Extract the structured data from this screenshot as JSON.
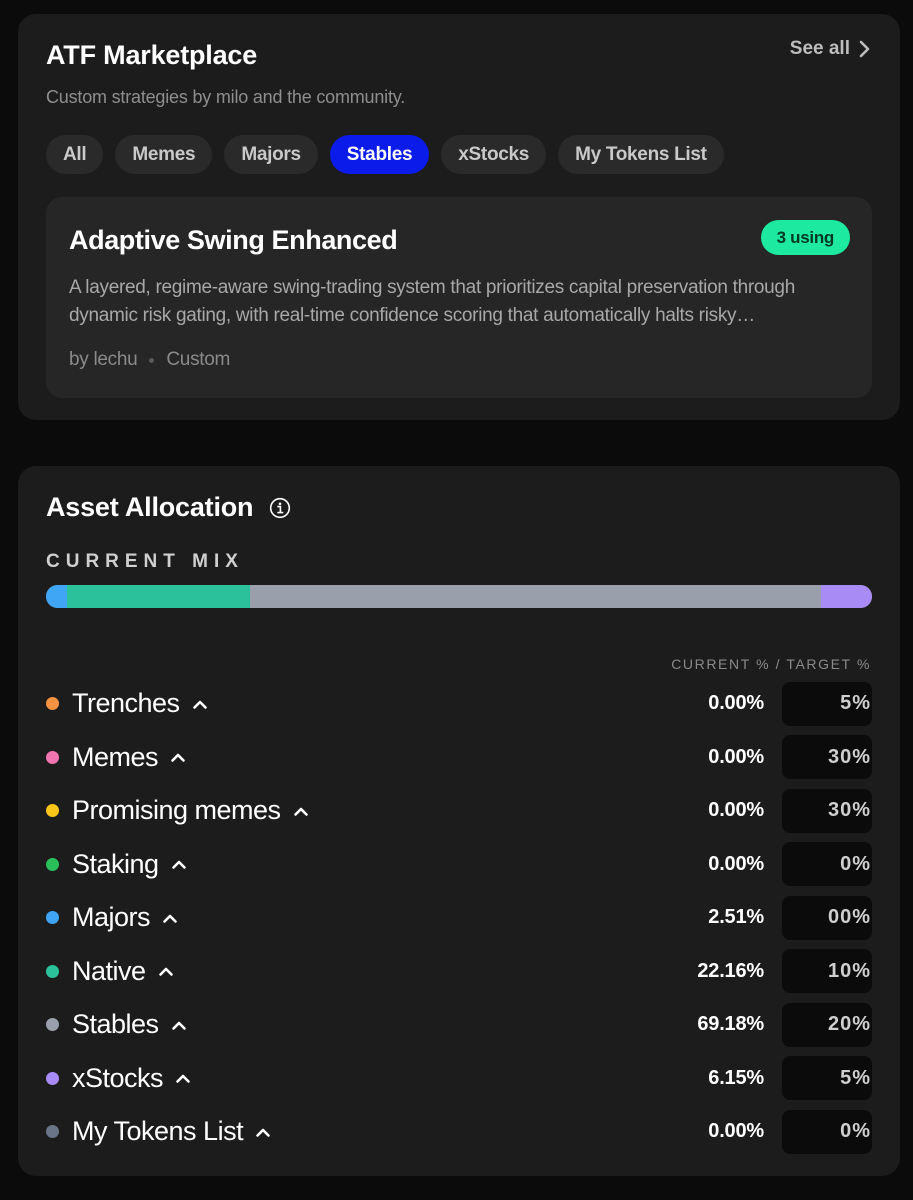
{
  "marketplace": {
    "title": "ATF Marketplace",
    "subtitle": "Custom strategies by milo and the community.",
    "see_all": "See all",
    "chips": [
      {
        "label": "All",
        "active": false
      },
      {
        "label": "Memes",
        "active": false
      },
      {
        "label": "Majors",
        "active": false
      },
      {
        "label": "Stables",
        "active": true
      },
      {
        "label": "xStocks",
        "active": false
      },
      {
        "label": "My Tokens List",
        "active": false
      }
    ],
    "strategy": {
      "title": "Adaptive Swing Enhanced",
      "badge": "3 using",
      "description": "A layered, regime-aware swing-trading system that prioritizes capital preservation through dynamic risk gating, with real-time confidence scoring that automatically halts risky…",
      "author": "by lechu",
      "type": "Custom"
    }
  },
  "allocation": {
    "title": "Asset Allocation",
    "mix_label": "CURRENT MIX",
    "column_header": "CURRENT % / TARGET %",
    "mix_segments": [
      {
        "name": "Majors",
        "percent": 2.51,
        "color": "#3ea6f5"
      },
      {
        "name": "Native",
        "percent": 22.16,
        "color": "#2bc29b"
      },
      {
        "name": "Stables",
        "percent": 69.18,
        "color": "#9aa0ab"
      },
      {
        "name": "xStocks",
        "percent": 6.15,
        "color": "#a98bf5"
      }
    ],
    "rows": [
      {
        "name": "Trenches",
        "color": "#f59342",
        "current": "0.00%",
        "target": "5%"
      },
      {
        "name": "Memes",
        "color": "#f074b0",
        "current": "0.00%",
        "target": "30%"
      },
      {
        "name": "Promising memes",
        "color": "#f7c619",
        "current": "0.00%",
        "target": "30%"
      },
      {
        "name": "Staking",
        "color": "#2bbf5c",
        "current": "0.00%",
        "target": "0%"
      },
      {
        "name": "Majors",
        "color": "#3ea6f5",
        "current": "2.51%",
        "target": "00%"
      },
      {
        "name": "Native",
        "color": "#2bc29b",
        "current": "22.16%",
        "target": "10%"
      },
      {
        "name": "Stables",
        "color": "#9aa0ab",
        "current": "69.18%",
        "target": "20%"
      },
      {
        "name": "xStocks",
        "color": "#a98bf5",
        "current": "6.15%",
        "target": "5%"
      },
      {
        "name": "My Tokens List",
        "color": "#6b7588",
        "current": "0.00%",
        "target": "0%"
      }
    ]
  },
  "icons": {
    "see_all": "chevron-right-icon",
    "info": "info-icon",
    "row_toggle": "chevron-up-icon"
  }
}
